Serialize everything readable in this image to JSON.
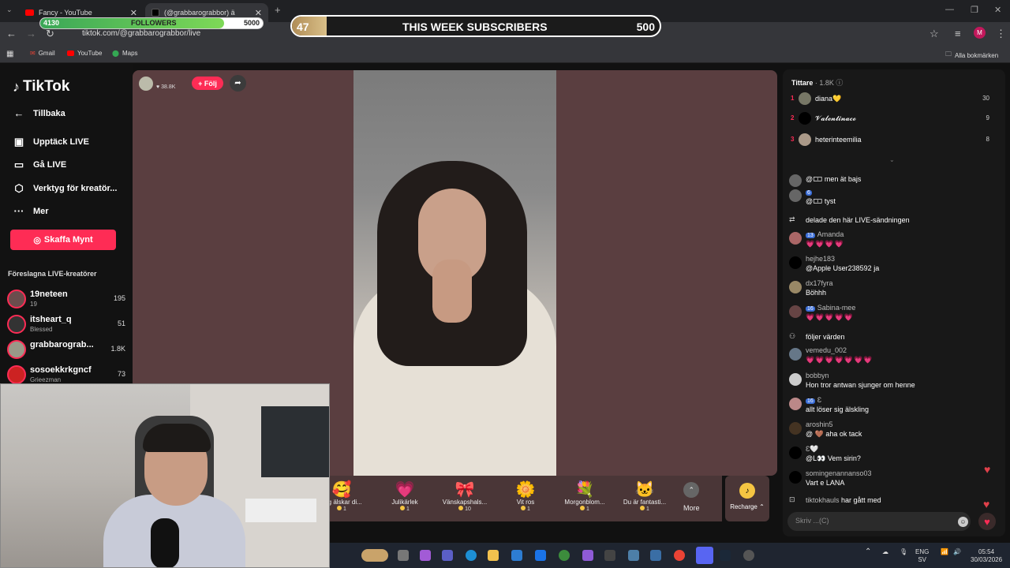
{
  "browser": {
    "tabs": [
      {
        "title": "Fancy - YouTube",
        "active": false
      },
      {
        "title": "(@grabbarograbbor) ä",
        "active": true
      }
    ],
    "new_tab": "+",
    "url": "tiktok.com/@grabbarograbbor/live",
    "bookmarks": [
      {
        "label": "Gmail"
      },
      {
        "label": "YouTube"
      },
      {
        "label": "Maps"
      }
    ],
    "all_bookmarks": "Alla bokmärken",
    "profile_initial": "M"
  },
  "overlay": {
    "followers": {
      "current": "4130",
      "label": "FOLLOWERS",
      "goal": "5000",
      "progress": 0.826
    },
    "subscribers": {
      "current": "47",
      "label": "THIS WEEK SUBSCRIBERS",
      "goal": "500",
      "progress": 0.094
    }
  },
  "sidebar": {
    "logo": "TikTok",
    "back": "Tillbaka",
    "nav": [
      {
        "label": "Upptäck LIVE",
        "icon": "live-tv-icon"
      },
      {
        "label": "Gå LIVE",
        "icon": "camera-icon"
      },
      {
        "label": "Verktyg för kreatör...",
        "icon": "tools-icon"
      },
      {
        "label": "Mer",
        "icon": "more-icon"
      }
    ],
    "coins_button": "Skaffa Mynt",
    "suggested_title": "Föreslagna LIVE-kreatörer",
    "suggested": [
      {
        "name": "19neteen",
        "sub": "19",
        "count": "195"
      },
      {
        "name": "itsheart_q",
        "sub": "Blessed",
        "count": "51"
      },
      {
        "name": "grabbarograb...",
        "sub": "",
        "count": "1.8K"
      },
      {
        "name": "sosoekkrkgncf",
        "sub": "Grieezman",
        "count": "73"
      }
    ]
  },
  "live": {
    "host_likes": "38.8K",
    "follow": "+ Följ"
  },
  "gifts": [
    {
      "name": "Jag älskar di...",
      "price": "1",
      "icon": "🥰"
    },
    {
      "name": "Julikärlek",
      "price": "1",
      "icon": "💗"
    },
    {
      "name": "Vänskapshals...",
      "price": "10",
      "icon": "🎀"
    },
    {
      "name": "Vit ros",
      "price": "1",
      "icon": "🌼"
    },
    {
      "name": "Morgonblom...",
      "price": "1",
      "icon": "💐"
    },
    {
      "name": "Du är fantasti...",
      "price": "1",
      "icon": "🐱"
    }
  ],
  "more_label": "More",
  "recharge_label": "Recharge",
  "chat": {
    "viewers_label": "Tittare",
    "viewers_count": "· 1.8K",
    "top_viewers": [
      {
        "rank": "1",
        "name": "diana💛",
        "score": "30"
      },
      {
        "rank": "2",
        "name": "𝓥𝓪𝓵𝓮𝓷𝓽𝓲𝓷𝓪𝓬𝓸",
        "score": "9"
      },
      {
        "rank": "3",
        "name": "heterinteemilia",
        "score": "8"
      }
    ],
    "messages": [
      {
        "user": "",
        "text": "@🀱 men ät bajs"
      },
      {
        "user": "6",
        "text": "@🀱 tyst"
      },
      {
        "user": "",
        "text": "delade den här LIVE-sändningen"
      },
      {
        "user": "Amanda",
        "level": "13",
        "text": "💗💗💗💗"
      },
      {
        "user": "hejhe183",
        "text": "@Apple User238592 ja"
      },
      {
        "user": "dx17fyra",
        "text": "Böhhh"
      },
      {
        "user": "Sabina-mee",
        "level": "16",
        "text": "💗💗💗💗💗"
      },
      {
        "user": "",
        "text": "följer värden"
      },
      {
        "user": "vemedu_002",
        "text": "💗💗💗💗💗💗💗"
      },
      {
        "user": "bobbyn",
        "text": "Hon tror antwan sjunger om henne"
      },
      {
        "user": "Ɛ",
        "level": "16",
        "text": "allt löser sig älskling"
      },
      {
        "user": "aroshin5",
        "text": "@ 🤎 aha ok tack"
      },
      {
        "user": "Ɛ🤍",
        "text": "@L👀 Vem sirin?"
      },
      {
        "user": "somingenannanso03",
        "text": "Vart e LANA"
      },
      {
        "user": "tiktokhauls",
        "text": "har gått med"
      }
    ],
    "input_placeholder": "Skriv ...(C)"
  },
  "taskbar": {
    "lang": "ENG",
    "region": "SV",
    "time": "05:54",
    "date": "30/03/2026"
  },
  "colors": {
    "tiktok_red": "#fe2c55",
    "live_bg": "#5a3e40",
    "followers_fill": "#3aa757",
    "subs_fill": "#d9bf88"
  }
}
